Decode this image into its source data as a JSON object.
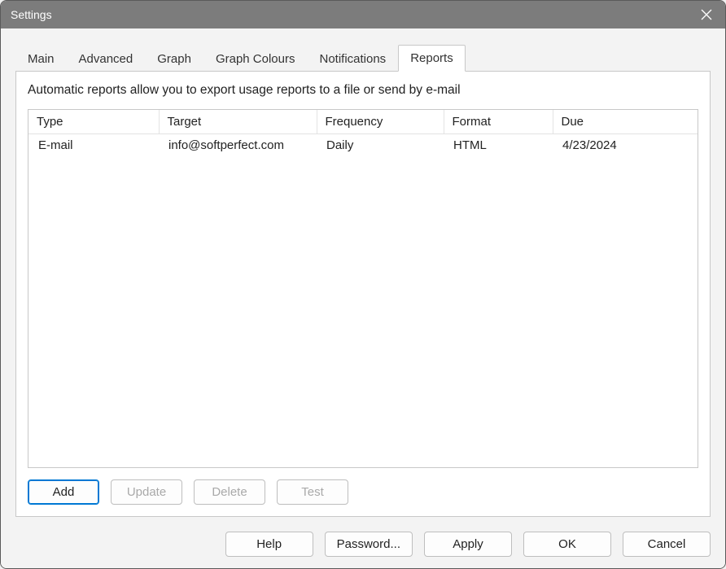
{
  "window": {
    "title": "Settings"
  },
  "tabs": {
    "main": "Main",
    "advanced": "Advanced",
    "graph": "Graph",
    "graph_colours": "Graph Colours",
    "notifications": "Notifications",
    "reports": "Reports"
  },
  "panel": {
    "description": "Automatic reports allow you to export usage reports to a file or send by e-mail"
  },
  "table": {
    "headers": {
      "type": "Type",
      "target": "Target",
      "frequency": "Frequency",
      "format": "Format",
      "due": "Due"
    },
    "rows": [
      {
        "type": "E-mail",
        "target": "info@softperfect.com",
        "frequency": "Daily",
        "format": "HTML",
        "due": "4/23/2024"
      }
    ]
  },
  "actions": {
    "add": "Add",
    "update": "Update",
    "delete": "Delete",
    "test": "Test"
  },
  "footer": {
    "help": "Help",
    "password": "Password...",
    "apply": "Apply",
    "ok": "OK",
    "cancel": "Cancel"
  }
}
